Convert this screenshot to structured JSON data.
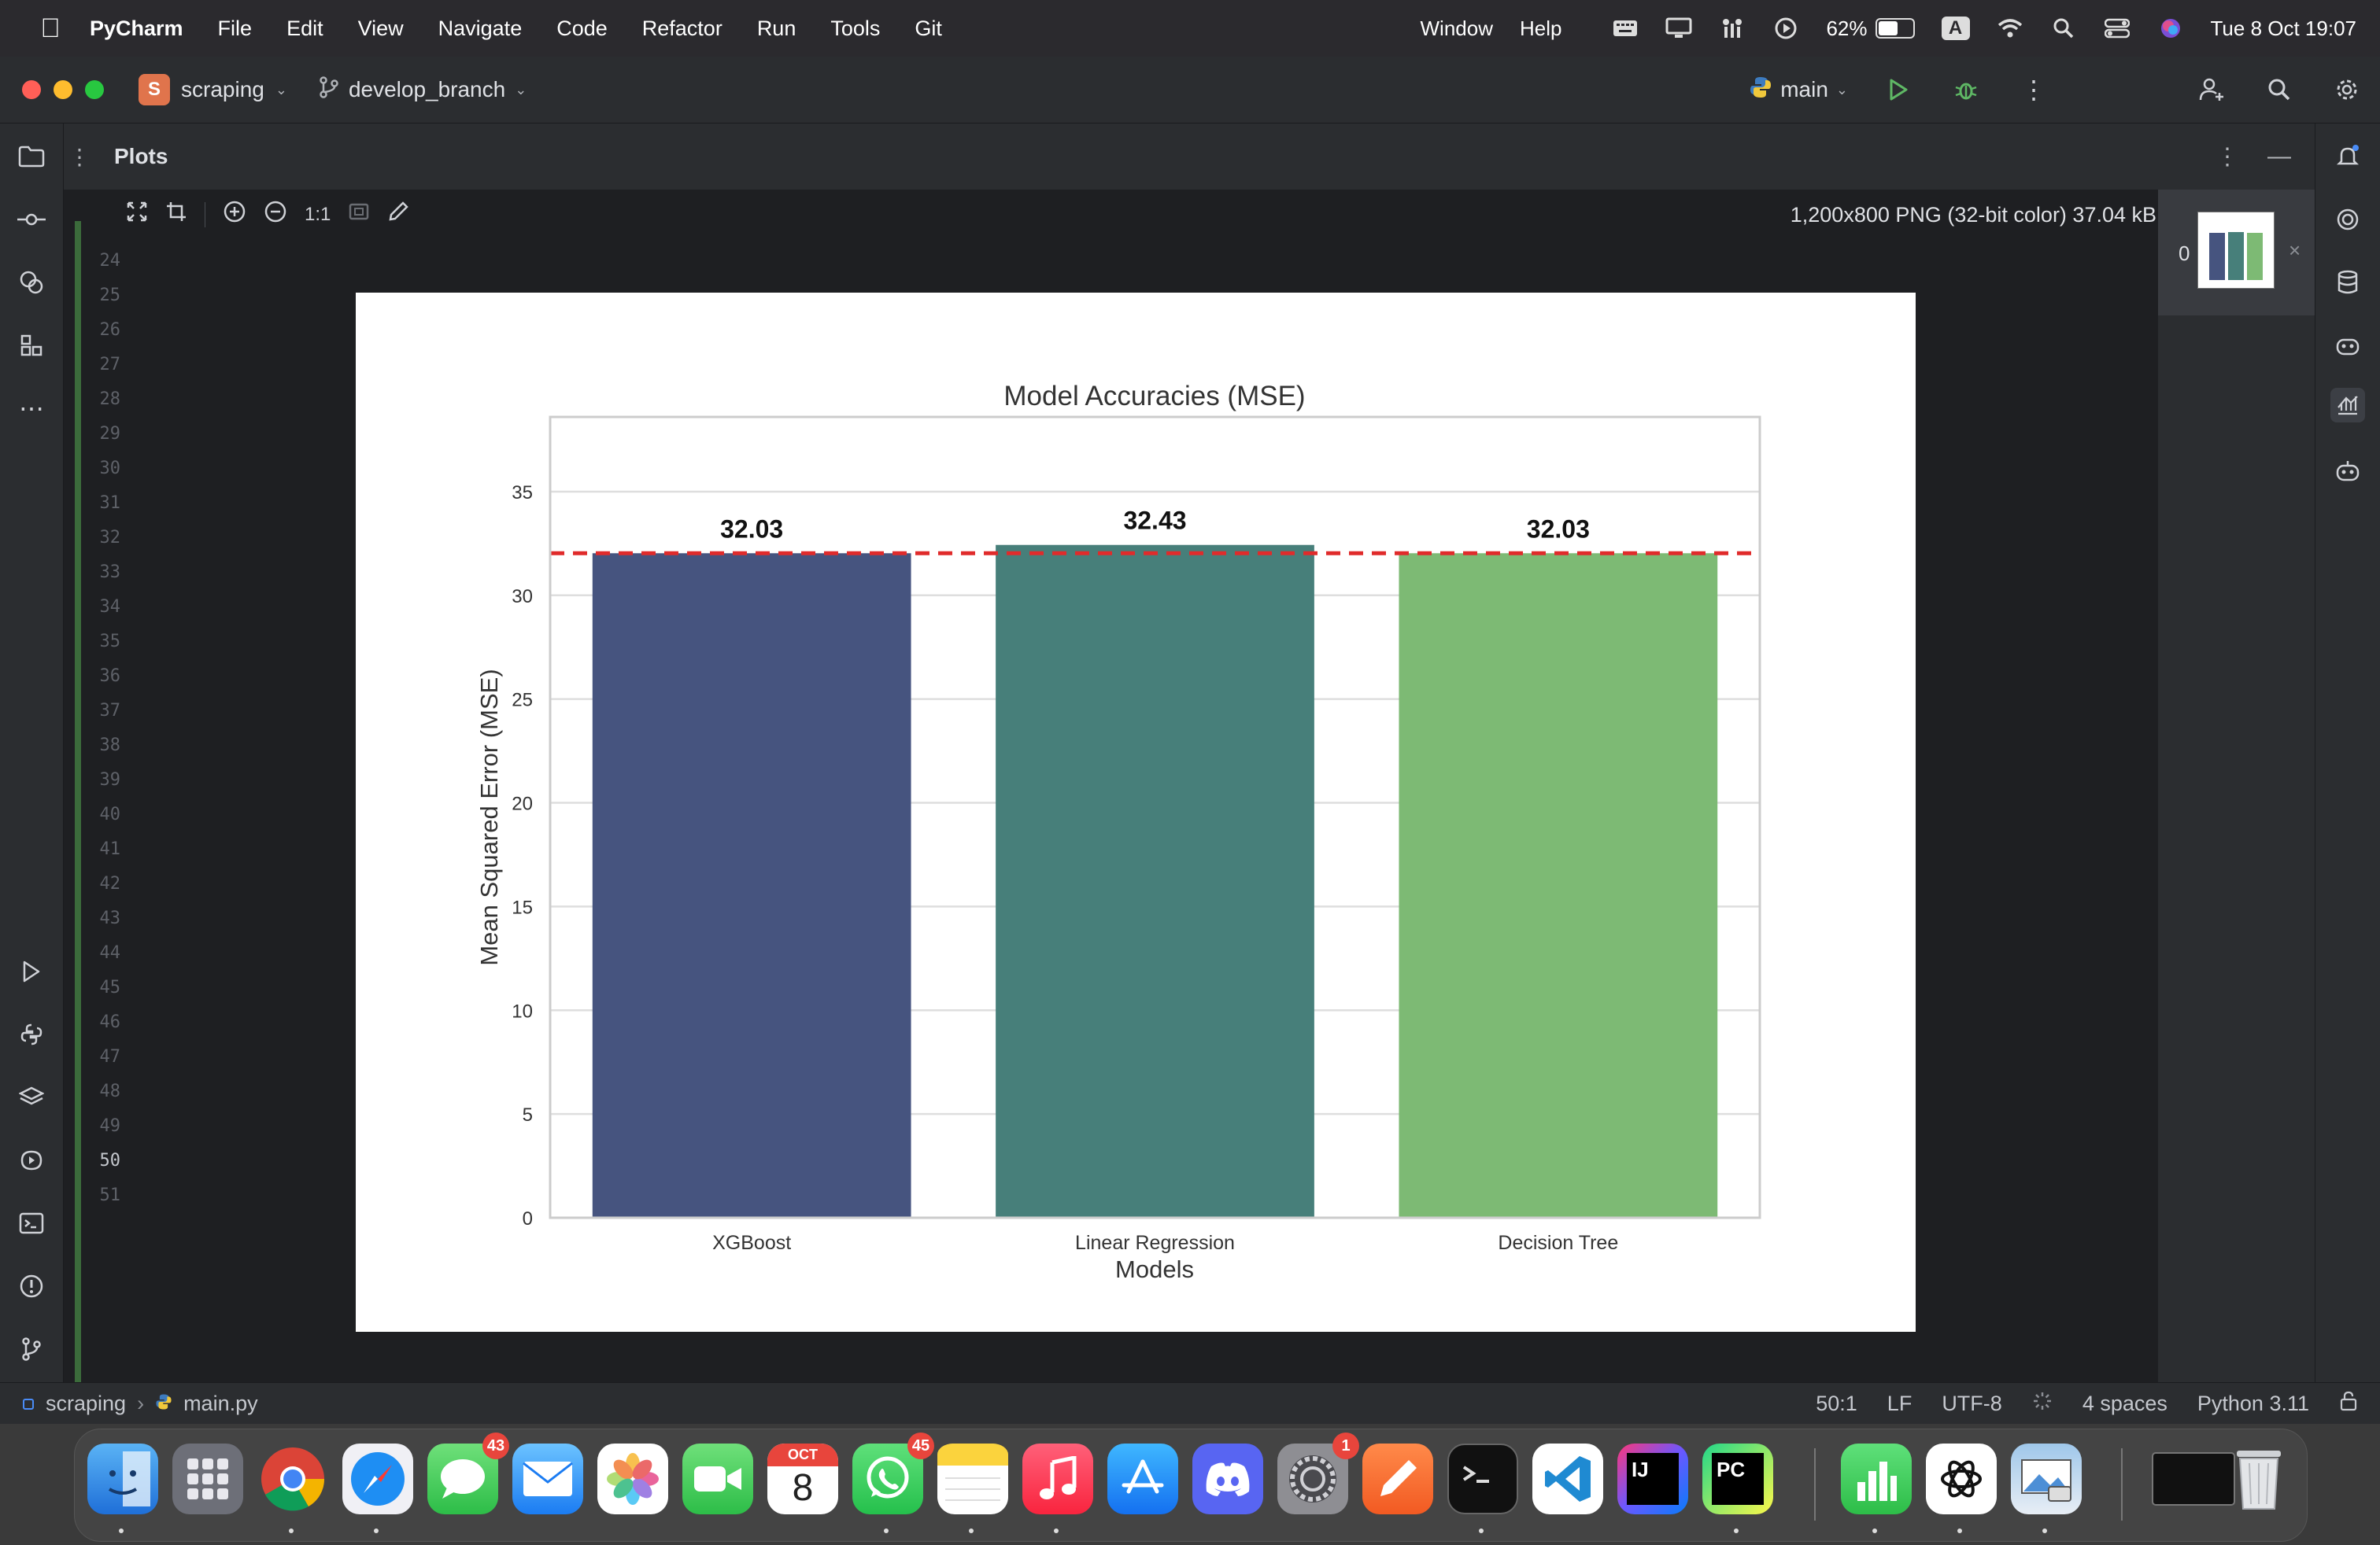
{
  "menubar": {
    "app_name": "PyCharm",
    "items": [
      "File",
      "Edit",
      "View",
      "Navigate",
      "Code",
      "Refactor",
      "Run",
      "Tools",
      "Git"
    ],
    "right_items": [
      "Window",
      "Help"
    ],
    "battery_percent": "62%",
    "battery_level": 0.62,
    "input_source": "A",
    "datetime": "Tue 8 Oct  19:07"
  },
  "titlebar": {
    "project_badge": "S",
    "project_name": "scraping",
    "branch_name": "develop_branch",
    "run_config": "main"
  },
  "toolwindow": {
    "title": "Plots",
    "zoom_actual": "1:1",
    "image_info": "1,200x800 PNG (32-bit color) 37.04 kB",
    "thumb_index": "0"
  },
  "gutter": {
    "line_numbers": [
      "24",
      "25",
      "26",
      "27",
      "28",
      "29",
      "30",
      "31",
      "32",
      "33",
      "34",
      "35",
      "36",
      "37",
      "38",
      "39",
      "40",
      "41",
      "42",
      "43",
      "44",
      "45",
      "46",
      "47",
      "48",
      "49",
      "50",
      "51"
    ],
    "active_line": "50"
  },
  "chart_data": {
    "type": "bar",
    "title": "Model Accuracies (MSE)",
    "xlabel": "Models",
    "ylabel": "Mean Squared Error (MSE)",
    "categories": [
      "XGBoost",
      "Linear Regression",
      "Decision Tree"
    ],
    "values": [
      32.03,
      32.43,
      32.03
    ],
    "value_labels": [
      "32.03",
      "32.43",
      "32.03"
    ],
    "colors": [
      "#46547f",
      "#477f7a",
      "#7dba74"
    ],
    "reference_line": {
      "value": 32.03,
      "color": "#e02b2b",
      "style": "dashed"
    },
    "ylim": [
      0,
      38.6
    ],
    "yticks": [
      0,
      5,
      10,
      15,
      20,
      25,
      30,
      35
    ],
    "grid": true
  },
  "statusbar": {
    "breadcrumb_project": "scraping",
    "breadcrumb_file": "main.py",
    "position": "50:1",
    "line_sep": "LF",
    "encoding": "UTF-8",
    "indent": "4 spaces",
    "interpreter": "Python 3.11"
  },
  "dock": {
    "badges": {
      "messages": "43",
      "whatsapp": "45",
      "settings": "1"
    },
    "calendar_month": "OCT",
    "calendar_day": "8",
    "intellij_label": "IJ",
    "pycharm_label": "PC"
  }
}
